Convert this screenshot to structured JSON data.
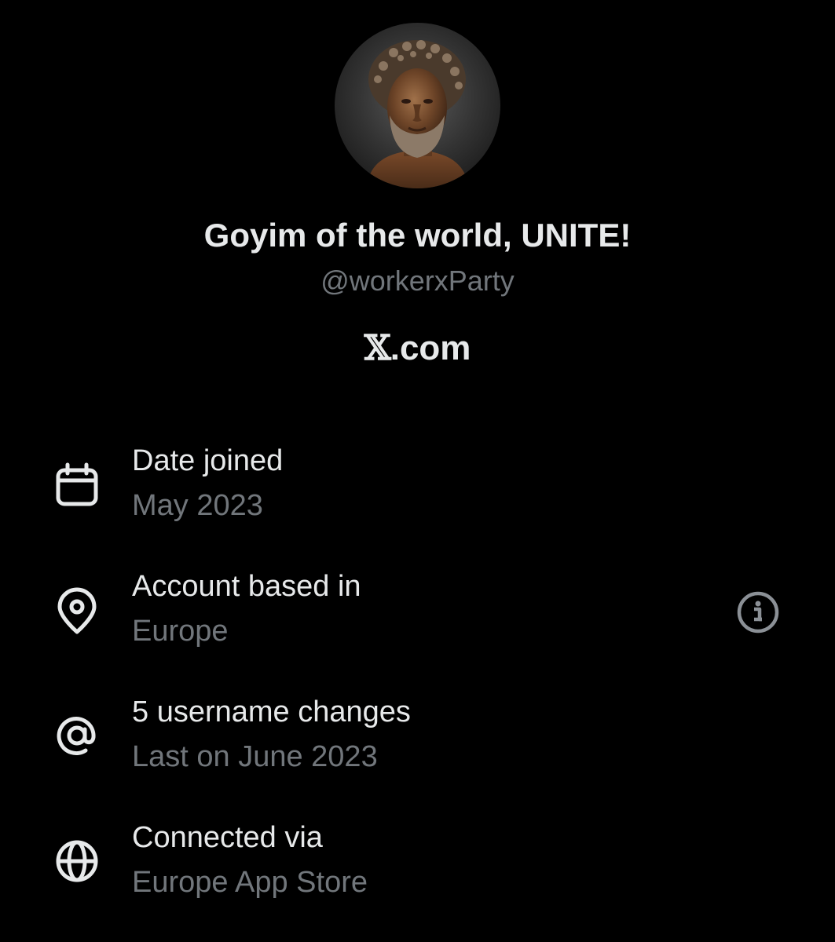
{
  "profile": {
    "display_name": "Goyim of the world, UNITE!",
    "handle": "@workerxParty"
  },
  "site": {
    "x_glyph": "𝕏",
    "domain": ".com"
  },
  "about": [
    {
      "icon": "calendar-icon",
      "title": "Date joined",
      "value": "May 2023"
    },
    {
      "icon": "location-pin-icon",
      "title": "Account based in",
      "value": "Europe"
    },
    {
      "icon": "at-sign-icon",
      "title": "5 username changes",
      "value": "Last on June 2023"
    },
    {
      "icon": "globe-icon",
      "title": "Connected via",
      "value": "Europe App Store"
    }
  ],
  "colors": {
    "background": "#000000",
    "primary_text": "#e7e9ea",
    "secondary_text": "#71767b"
  }
}
